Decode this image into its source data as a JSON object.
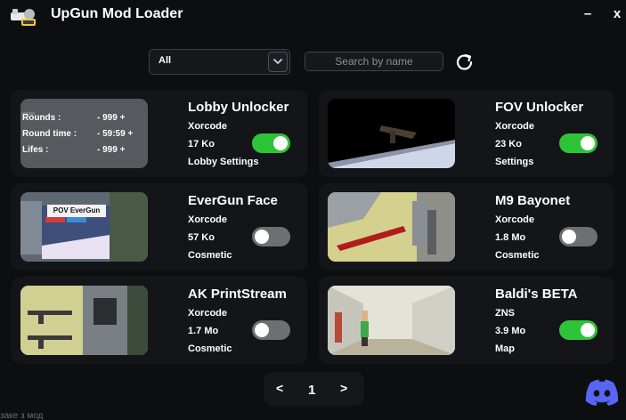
{
  "app": {
    "title": "UpGun Mod Loader"
  },
  "window": {
    "minimize_label": "–",
    "close_label": "x"
  },
  "toolbar": {
    "filter_value": "All",
    "search_placeholder": "Search by name"
  },
  "mods": [
    {
      "name": "Lobby Unlocker",
      "author": "Xorcode",
      "size": "17 Ko",
      "category": "Lobby Settings",
      "enabled": true
    },
    {
      "name": "FOV Unlocker",
      "author": "Xorcode",
      "size": "23 Ko",
      "category": "Settings",
      "enabled": true
    },
    {
      "name": "EverGun Face",
      "author": "Xorcode",
      "size": "57 Ko",
      "category": "Cosmetic",
      "enabled": false
    },
    {
      "name": "M9 Bayonet",
      "author": "Xorcode",
      "size": "1.8 Mo",
      "category": "Cosmetic",
      "enabled": false
    },
    {
      "name": "AK PrintStream",
      "author": "Xorcode",
      "size": "1.7 Mo",
      "category": "Cosmetic",
      "enabled": false
    },
    {
      "name": "Baldi's BETA",
      "author": "ZNS",
      "size": "3.9 Mo",
      "category": "Map",
      "enabled": true
    }
  ],
  "lobby_thumb": {
    "rows": [
      {
        "label": "Rounds :",
        "value": "- 999 +"
      },
      {
        "label": "Round time :",
        "value": "- 59:59 +"
      },
      {
        "label": "Lifes :",
        "value": "- 999 +"
      }
    ]
  },
  "evergun_thumb": {
    "sign": "POV EverGun"
  },
  "pager": {
    "prev": "<",
    "current": "1",
    "next": ">"
  },
  "footer": {
    "text": "заке з мод"
  },
  "colors": {
    "toggle_on": "#2ec438",
    "toggle_off": "#6e6f72",
    "discord": "#5865f2",
    "background": "#0d0e10"
  }
}
